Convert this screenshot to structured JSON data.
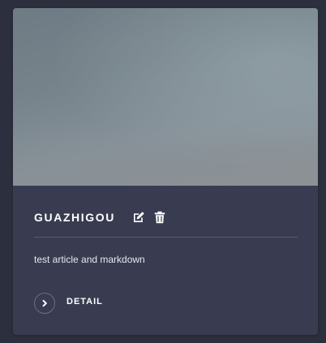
{
  "card": {
    "title": "GUAZHIGOU",
    "description": "test article and markdown",
    "detail_label": "DETAIL",
    "icons": {
      "edit": "edit-icon",
      "delete": "trash-icon",
      "detail": "chevron-right-icon"
    }
  },
  "colors": {
    "page_background": "#2c2f3e",
    "card_background": "#393c50",
    "text": "#ffffff",
    "divider": "#5a5d70"
  }
}
